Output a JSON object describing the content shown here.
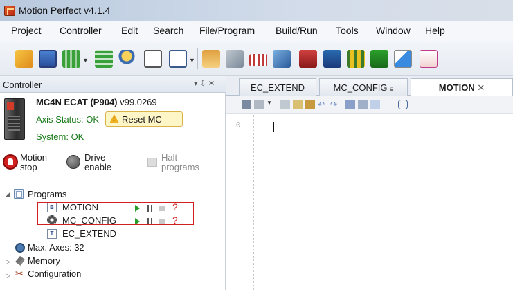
{
  "window": {
    "title": "Motion Perfect v4.1.4"
  },
  "menu": [
    "Project",
    "Controller",
    "Edit",
    "Search",
    "File/Program",
    "Build/Run",
    "Tools",
    "Window",
    "Help"
  ],
  "controller_panel": {
    "title": "Controller",
    "pin": "▾ ⇩ ✕",
    "device_model": "MC4N ECAT (P904)",
    "device_version": "v99.0269",
    "axis_status": "Axis Status: OK",
    "reset_label": "Reset MC",
    "system_status": "System: OK",
    "motion_stop_1": "Motion",
    "motion_stop_2": "stop",
    "drive_enable_1": "Drive",
    "drive_enable_2": "enable",
    "halt_programs_1": "Halt",
    "halt_programs_2": "programs"
  },
  "tree": {
    "programs": "Programs",
    "items": [
      {
        "name": "MOTION",
        "icon": "B",
        "status": "?"
      },
      {
        "name": "MC_CONFIG",
        "icon": "gear",
        "status": "?"
      },
      {
        "name": "EC_EXTEND",
        "icon": "T"
      }
    ],
    "max_axes": "Max. Axes: 32",
    "memory": "Memory",
    "configuration": "Configuration"
  },
  "tabs": [
    {
      "label": "EC_EXTEND",
      "active": false
    },
    {
      "label": "MC_CONFIG",
      "active": false,
      "locked": true
    },
    {
      "label": "MOTION",
      "active": true,
      "close": "✕"
    }
  ],
  "editor": {
    "line_number": "0"
  }
}
